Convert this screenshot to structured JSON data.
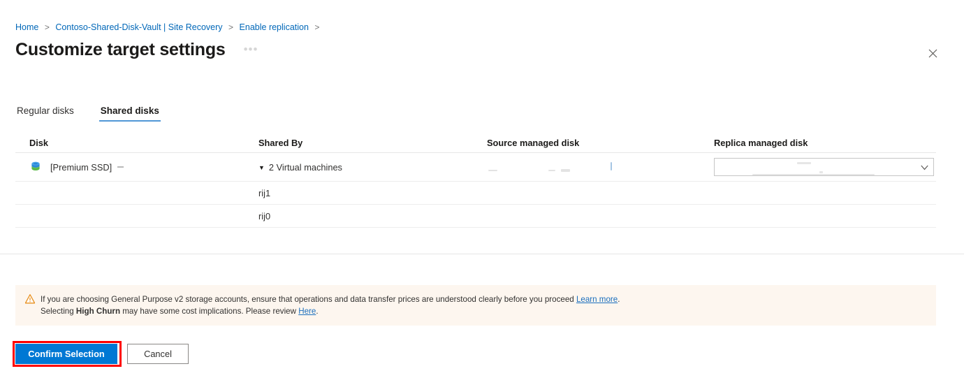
{
  "breadcrumb": {
    "items": [
      {
        "label": "Home"
      },
      {
        "label": "Contoso-Shared-Disk-Vault | Site Recovery"
      },
      {
        "label": "Enable replication"
      }
    ],
    "separator": ">"
  },
  "header": {
    "title": "Customize target settings",
    "ellipsis_label": "•••",
    "close_label": "Close"
  },
  "tabs": [
    {
      "label": "Regular disks",
      "active": false
    },
    {
      "label": "Shared disks",
      "active": true
    }
  ],
  "table": {
    "columns": [
      {
        "key": "disk",
        "label": "Disk"
      },
      {
        "key": "shared_by",
        "label": "Shared By"
      },
      {
        "key": "source_managed_disk",
        "label": "Source managed disk"
      },
      {
        "key": "replica_managed_disk",
        "label": "Replica managed disk"
      }
    ],
    "rows": [
      {
        "type": "parent",
        "disk_icon": "managed-disk-icon",
        "disk": "[Premium SSD]",
        "disk_redacted": true,
        "expander": "▼",
        "shared_by": "2 Virtual machines",
        "source_managed_disk": "",
        "source_redacted": true,
        "replica_managed_disk": "",
        "replica_control": "dropdown"
      },
      {
        "type": "child",
        "disk": "",
        "shared_by": "rij1",
        "source_managed_disk": "",
        "replica_managed_disk": ""
      },
      {
        "type": "child",
        "disk": "",
        "shared_by": "rij0",
        "source_managed_disk": "",
        "replica_managed_disk": ""
      }
    ]
  },
  "warning": {
    "icon": "warning-triangle-icon",
    "line1_prefix": "If you are choosing General Purpose v2 storage accounts, ensure that operations and data transfer prices are understood clearly before you proceed ",
    "line1_link": "Learn more",
    "line1_suffix": ".",
    "line2_prefix": "Selecting ",
    "line2_bold": "High Churn",
    "line2_middle": " may have some cost implications. Please review ",
    "line2_link": "Here",
    "line2_suffix": "."
  },
  "footer": {
    "confirm_label": "Confirm Selection",
    "cancel_label": "Cancel"
  },
  "colors": {
    "accent": "#0078d4",
    "link": "#0067b8",
    "tab_underline": "#5197d6",
    "warning_bg": "#fdf6ef",
    "warning_icon": "#e8901f",
    "highlight": "#ff0000"
  }
}
